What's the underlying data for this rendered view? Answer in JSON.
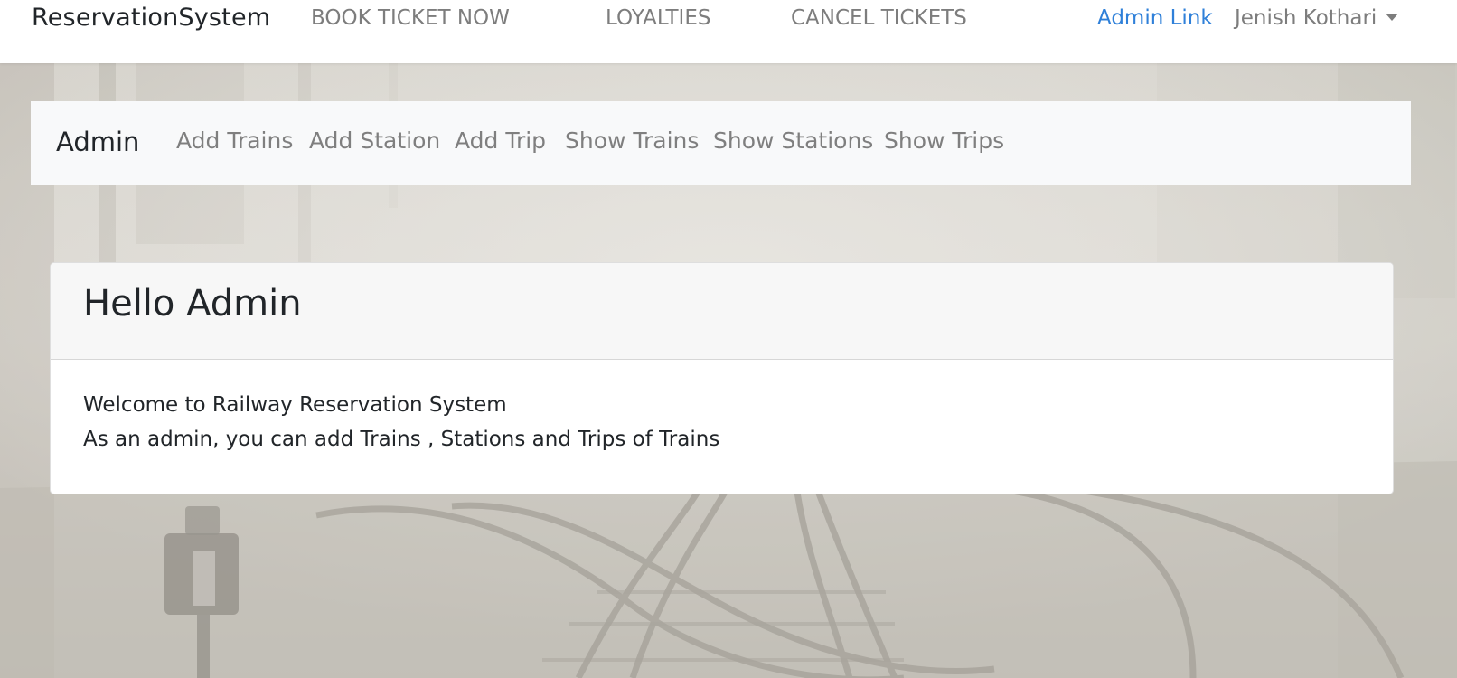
{
  "topnav": {
    "brand": "ReservationSystem",
    "links": [
      {
        "label": "BOOK TICKET NOW"
      },
      {
        "label": "LOYALTIES"
      },
      {
        "label": "CANCEL TICKETS"
      }
    ],
    "admin_link": "Admin Link",
    "user_name": "Jenish Kothari",
    "admin_link_color": "#2f80d9"
  },
  "subnav": {
    "brand": "Admin",
    "links": [
      {
        "label": "Add Trains"
      },
      {
        "label": "Add Station"
      },
      {
        "label": "Add Trip"
      },
      {
        "label": "Show Trains"
      },
      {
        "label": "Show Stations"
      },
      {
        "label": "Show Trips"
      }
    ]
  },
  "card": {
    "title": "Hello Admin",
    "lines": [
      "Welcome to Railway Reservation System",
      "As an admin, you can add Trains , Stations and Trips of Trains"
    ]
  },
  "background": {
    "icon": "railway-tracks-fog-image"
  }
}
